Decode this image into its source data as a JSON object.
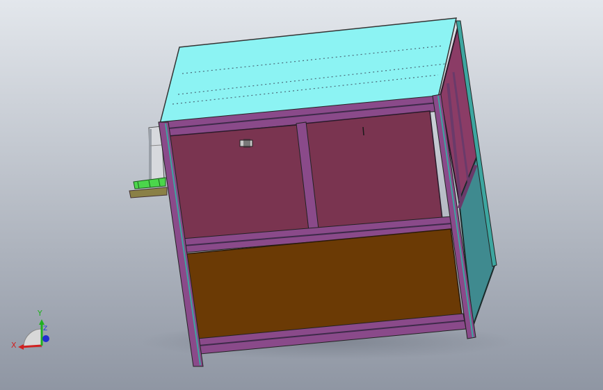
{
  "viewport": {
    "background_top": "#e3e7ec",
    "background_bottom": "#8f96a3"
  },
  "model": {
    "colors": {
      "top_panel": "#8cf3f3",
      "frame": "#8a4a8a",
      "frame_dark": "#3e2a4a",
      "front_panel": "#7a3450",
      "side_panel_upper": "#8b3c66",
      "side_panel_lower": "#3f8a8f",
      "lower_panel": "#6b3a05",
      "green_part": "#4bd64b",
      "cyan_edge": "#3da6a0"
    }
  },
  "triad": {
    "x_label": "X",
    "y_label": "Y",
    "z_label": "Z",
    "x_color": "#d02020",
    "y_color": "#20b020",
    "z_color": "#2030d0"
  }
}
